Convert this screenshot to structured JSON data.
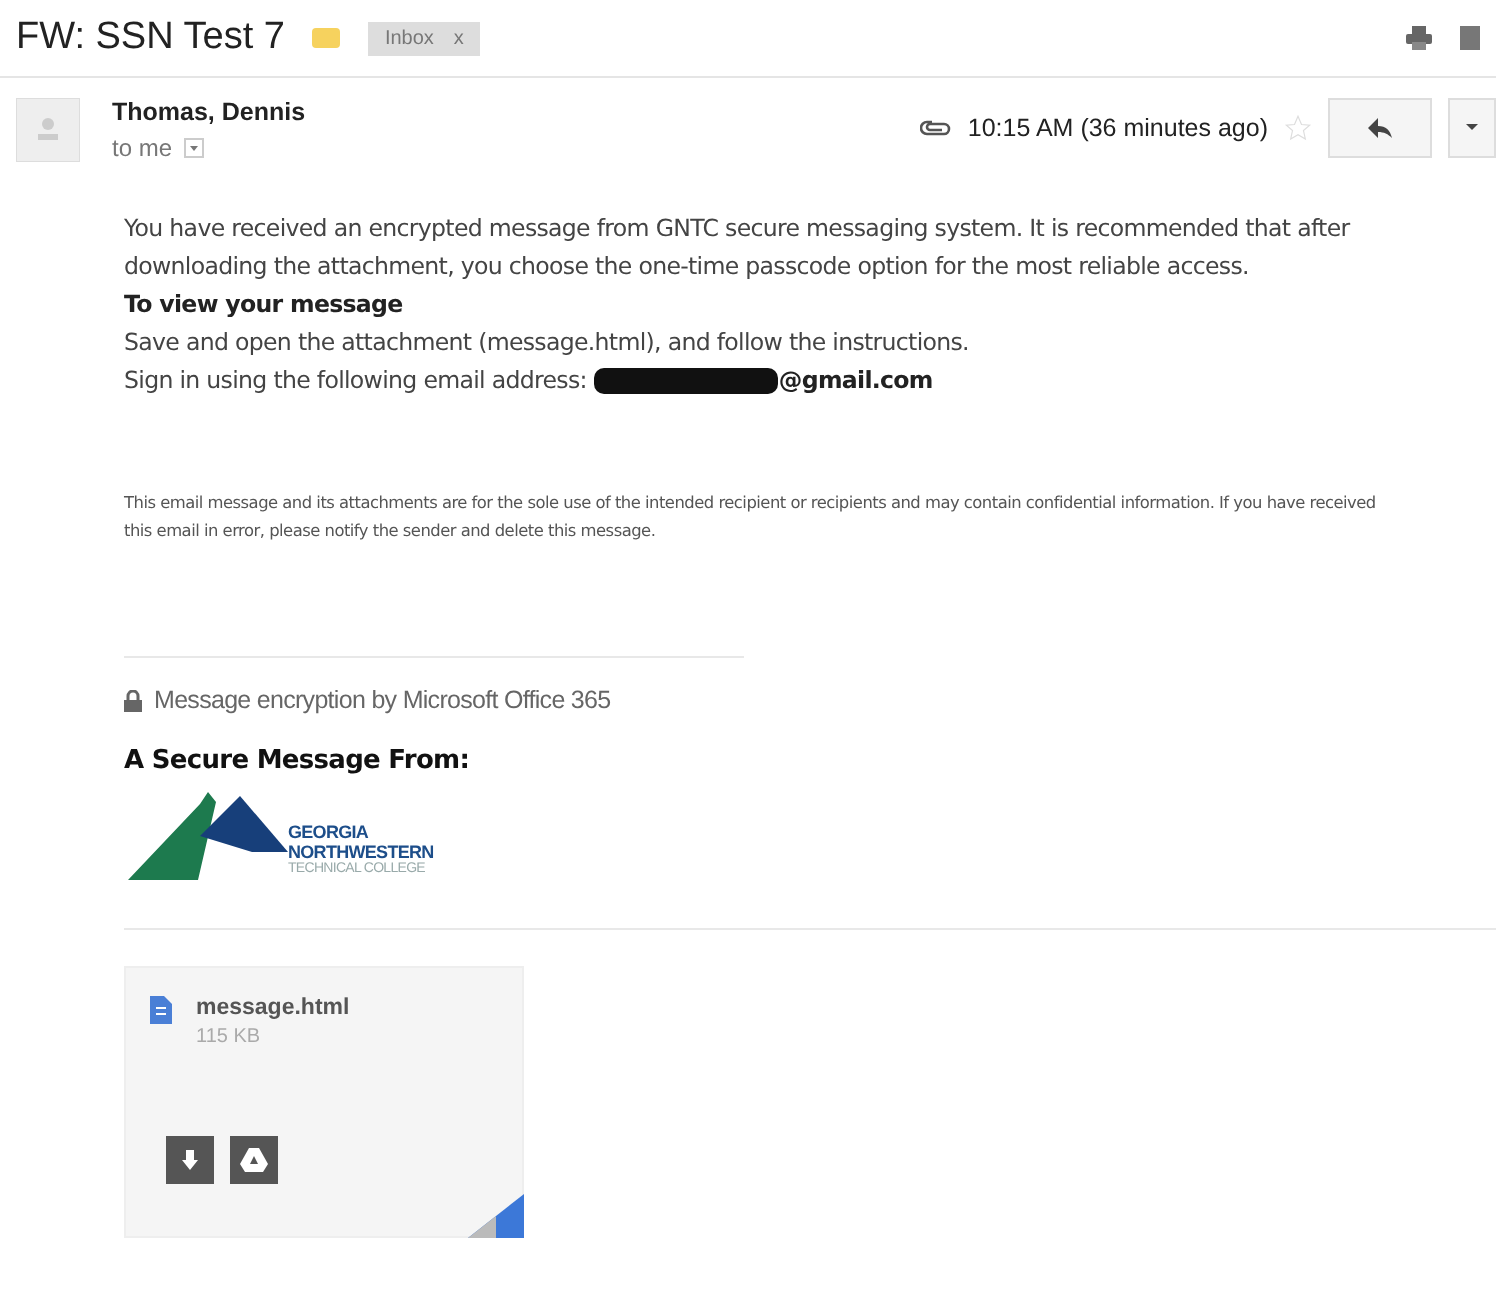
{
  "subject": "FW: SSN Test 7",
  "label": {
    "text": "Inbox",
    "close": "x"
  },
  "sender": {
    "name": "Thomas, Dennis",
    "recipient": "to me",
    "time": "10:15 AM (36 minutes ago)",
    "starred": false
  },
  "body": {
    "intro": "You have received an encrypted message from GNTC secure messaging system. It is recommended that after downloading the attachment, you choose the one-time passcode option for the most reliable access.",
    "heading": "To view your message",
    "instruction": "Save and open the attachment (message.html), and follow the instructions.",
    "sign_in": "Sign in using the following email address:",
    "email_domain": "@gmail.com",
    "disclaimer": "This email message and its attachments are for the sole use of the intended recipient or recipients and may contain confidential information. If you have received this email in error, please notify the sender and delete this message.",
    "encryption": "Message encryption by Microsoft Office 365",
    "secure_from": "A Secure Message From:",
    "logo_lines": [
      "GEORGIA",
      "NORTHWESTERN",
      "TECHNICAL COLLEGE"
    ]
  },
  "attachment": {
    "name": "message.html",
    "size": "115 KB"
  }
}
